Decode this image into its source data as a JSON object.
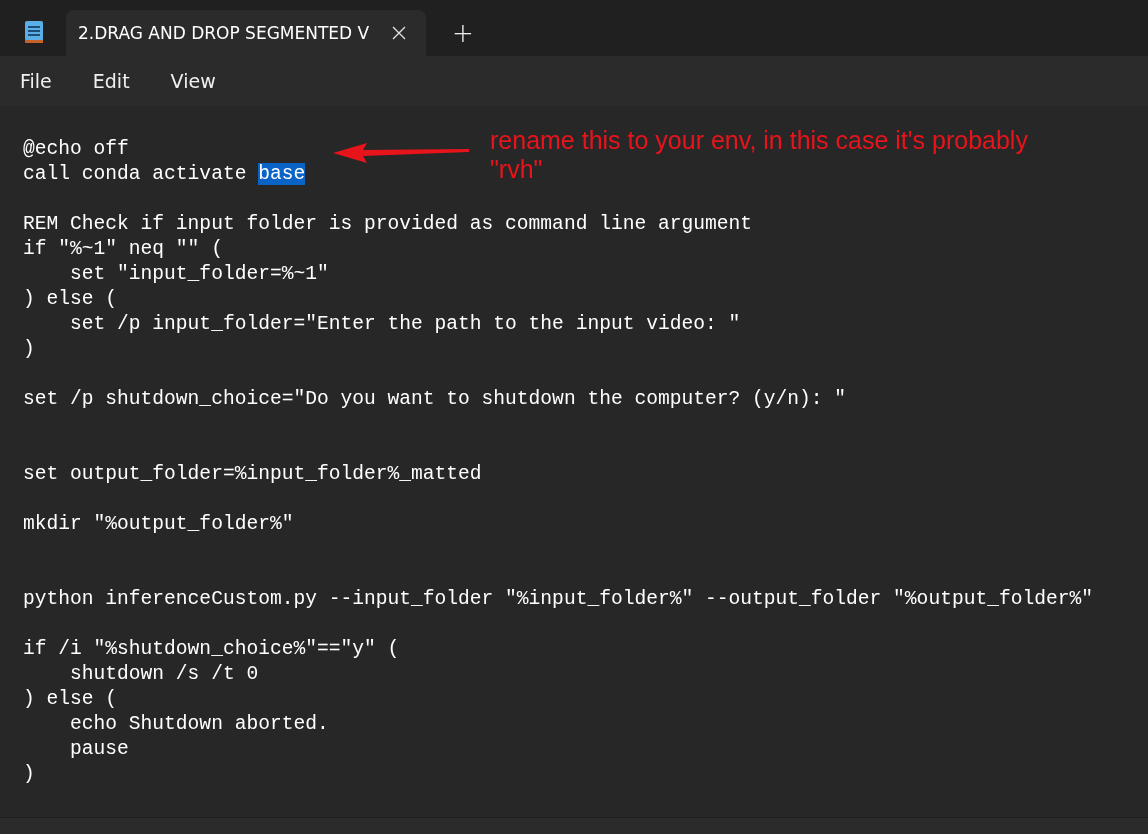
{
  "tabs": [
    {
      "label": "2.DRAG AND DROP SEGMENTED V",
      "selected": true
    }
  ],
  "new_tab": "+",
  "menu": [
    "File",
    "Edit",
    "View"
  ],
  "editor": {
    "lines": [
      {
        "kind": "code",
        "text": "@echo off"
      },
      {
        "kind": "code",
        "text": "call conda activate ",
        "selection": "base"
      },
      {
        "kind": "blank"
      },
      {
        "kind": "code",
        "text": "REM Check if input folder is provided as command line argument"
      },
      {
        "kind": "code",
        "text": "if \"%~1\" neq \"\" ("
      },
      {
        "kind": "code",
        "text": "    set \"input_folder=%~1\""
      },
      {
        "kind": "code",
        "text": ") else ("
      },
      {
        "kind": "code",
        "text": "    set /p input_folder=\"Enter the path to the input video: \""
      },
      {
        "kind": "code",
        "text": ")"
      },
      {
        "kind": "blank"
      },
      {
        "kind": "code",
        "text": "set /p shutdown_choice=\"Do you want to shutdown the computer? (y/n): \""
      },
      {
        "kind": "blank"
      },
      {
        "kind": "blank"
      },
      {
        "kind": "code",
        "text": "set output_folder=%input_folder%_matted"
      },
      {
        "kind": "blank"
      },
      {
        "kind": "code",
        "text": "mkdir \"%output_folder%\""
      },
      {
        "kind": "blank"
      },
      {
        "kind": "blank"
      },
      {
        "kind": "code",
        "text": "python inferenceCustom.py --input_folder \"%input_folder%\" --output_folder \"%output_folder%\""
      },
      {
        "kind": "blank"
      },
      {
        "kind": "code",
        "text": "if /i \"%shutdown_choice%\"==\"y\" ("
      },
      {
        "kind": "code",
        "text": "    shutdown /s /t 0"
      },
      {
        "kind": "code",
        "text": ") else ("
      },
      {
        "kind": "code",
        "text": "    echo Shutdown aborted."
      },
      {
        "kind": "code",
        "text": "    pause"
      },
      {
        "kind": "code",
        "text": ")"
      }
    ]
  },
  "annotation": {
    "lines": [
      "rename this to your env, in this case it's probably",
      "\"rvh\""
    ]
  }
}
